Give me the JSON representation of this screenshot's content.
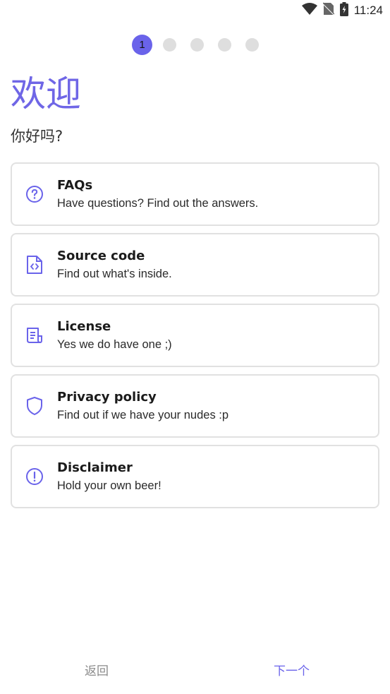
{
  "status_bar": {
    "time": "11:24",
    "icons": [
      "wifi-icon",
      "no-sim-icon",
      "battery-charging-icon"
    ]
  },
  "stepper": {
    "current_label": "1",
    "total_steps": 5,
    "accent": "#6a63ea"
  },
  "header": {
    "title": "欢迎",
    "subtitle": "你好吗?"
  },
  "cards": [
    {
      "icon": "question-circle-icon",
      "title": "FAQs",
      "description": "Have questions? Find out the answers."
    },
    {
      "icon": "code-file-icon",
      "title": "Source code",
      "description": "Find out what's inside."
    },
    {
      "icon": "document-icon",
      "title": "License",
      "description": "Yes we do have one ;)"
    },
    {
      "icon": "shield-icon",
      "title": "Privacy policy",
      "description": "Find out if we have your nudes :p"
    },
    {
      "icon": "exclamation-circle-icon",
      "title": "Disclaimer",
      "description": "Hold your own beer!"
    }
  ],
  "nav": {
    "back_label": "返回",
    "next_label": "下一个"
  },
  "colors": {
    "accent": "#6a63ea",
    "card_border": "#e1e1e1",
    "inactive_dot": "#dedede"
  }
}
